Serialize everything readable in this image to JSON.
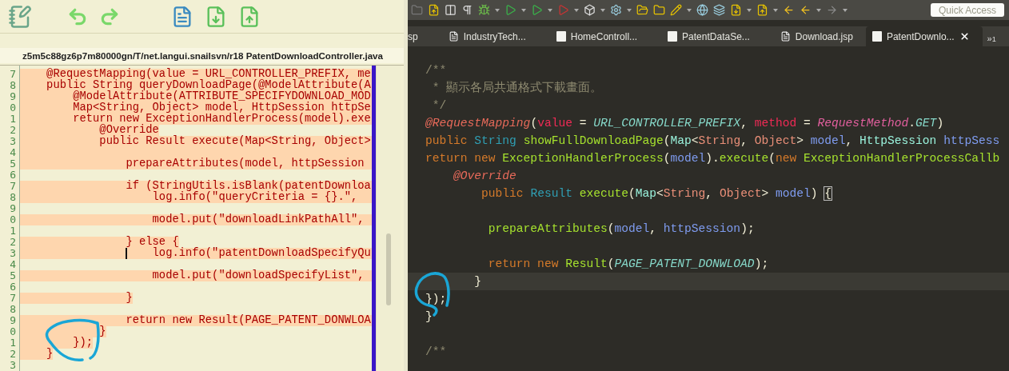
{
  "compare_panel": {
    "file_path": "z5m5c88gz6p7m80000gn/T/net.langui.snailsvn/r18 PatentDownloadController.java",
    "lines": [
      {
        "number": "7",
        "changed": true,
        "kind": "full",
        "cursor": false,
        "text": "    @RequestMapping(value = URL_CONTROLLER_PREFIX, me"
      },
      {
        "number": "8",
        "changed": true,
        "kind": "full",
        "cursor": false,
        "text": "    public String queryDownloadPage(@ModelAttribute(A"
      },
      {
        "number": "9",
        "changed": true,
        "kind": "full",
        "cursor": false,
        "text": "        @ModelAttribute(ATTRIBUTE_SPECIFYDOWNLOAD_MOD"
      },
      {
        "number": "0",
        "changed": true,
        "kind": "full",
        "cursor": false,
        "text": "        Map<String, Object> model, HttpSession httpSe"
      },
      {
        "number": "1",
        "changed": true,
        "kind": "full",
        "cursor": false,
        "text": "        return new ExceptionHandlerProcess(model).exe"
      },
      {
        "number": "2",
        "changed": true,
        "kind": "text",
        "cursor": false,
        "text": "            @Override"
      },
      {
        "number": "3",
        "changed": true,
        "kind": "full",
        "cursor": false,
        "text": "            public Result execute(Map<String, Object>"
      },
      {
        "number": "4",
        "changed": true,
        "kind": "full",
        "cursor": false
      },
      {
        "number": "5",
        "changed": true,
        "kind": "full",
        "cursor": false,
        "text": "                prepareAttributes(model, httpSession"
      },
      {
        "number": "6",
        "changed": false,
        "cursor": false
      },
      {
        "number": "7",
        "changed": true,
        "kind": "full",
        "cursor": false,
        "text": "                if (StringUtils.isBlank(patentDownloa"
      },
      {
        "number": "8",
        "changed": true,
        "kind": "full",
        "cursor": false,
        "text": "                    log.info(\"queryCriteria = {}.\","
      },
      {
        "number": "9",
        "changed": false,
        "cursor": false
      },
      {
        "number": "0",
        "changed": true,
        "kind": "full",
        "cursor": false,
        "text": "                    model.put(\"downloadLinkPathAll\","
      },
      {
        "number": "1",
        "changed": false,
        "cursor": false
      },
      {
        "number": "2",
        "changed": true,
        "kind": "text",
        "cursor": false,
        "text": "                } else {"
      },
      {
        "number": "3",
        "changed": true,
        "kind": "full",
        "cursor": true,
        "text": "                    log.info(\"patentDownloadSpecifyQu"
      },
      {
        "number": "4",
        "changed": false,
        "cursor": false
      },
      {
        "number": "5",
        "changed": true,
        "kind": "full",
        "cursor": false,
        "text": "                    model.put(\"downloadSpecifyList\","
      },
      {
        "number": "6",
        "changed": false,
        "cursor": false
      },
      {
        "number": "7",
        "changed": true,
        "kind": "text",
        "cursor": false,
        "text": "                }"
      },
      {
        "number": "8",
        "changed": false,
        "cursor": false
      },
      {
        "number": "9",
        "changed": true,
        "kind": "full",
        "cursor": false,
        "text": "                return new Result(PAGE_PATENT_DONWLOA"
      },
      {
        "number": "0",
        "changed": true,
        "kind": "text",
        "cursor": false,
        "text": "            }"
      },
      {
        "number": "1",
        "changed": true,
        "kind": "text",
        "cursor": false,
        "text": "        });"
      },
      {
        "number": "2",
        "changed": true,
        "kind": "text",
        "cursor": false,
        "text": "    }"
      },
      {
        "number": "3",
        "changed": false,
        "cursor": false
      }
    ]
  },
  "ide": {
    "quick_access": {
      "placeholder": "Quick Access"
    },
    "tabs": [
      {
        "label": "sp",
        "kind": "cut",
        "selected": false
      },
      {
        "label": "IndustryTech...",
        "kind": "jsp",
        "selected": false
      },
      {
        "label": "HomeControll...",
        "kind": "java",
        "selected": false
      },
      {
        "label": "PatentDataSe...",
        "kind": "java",
        "selected": false
      },
      {
        "label": "Download.jsp",
        "kind": "jsp",
        "selected": false
      },
      {
        "label": "PatentDownlo...",
        "kind": "java",
        "selected": true
      }
    ],
    "overflow": {
      "label": "»",
      "count": "1"
    },
    "lines": [
      {
        "current": false,
        "tokens": [
          {
            "text": "/**",
            "kind": "comment"
          }
        ]
      },
      {
        "current": false,
        "tokens": [
          {
            "text": " * 顯示各局共通格式下載畫面。",
            "kind": "comment"
          }
        ]
      },
      {
        "current": false,
        "tokens": [
          {
            "text": " */",
            "kind": "comment"
          }
        ]
      },
      {
        "current": false,
        "tokens": [
          {
            "text": "@RequestMapping",
            "kind": "annotation"
          },
          {
            "text": "(",
            "kind": "plain"
          },
          {
            "text": "value",
            "kind": "attr"
          },
          {
            "text": " = ",
            "kind": "plain"
          },
          {
            "text": "URL_CONTROLLER_PREFIX",
            "kind": "constant"
          },
          {
            "text": ", ",
            "kind": "plain"
          },
          {
            "text": "method",
            "kind": "attr"
          },
          {
            "text": " = ",
            "kind": "plain"
          },
          {
            "text": "RequestMethod",
            "kind": "static"
          },
          {
            "text": ".",
            "kind": "plain"
          },
          {
            "text": "GET",
            "kind": "constant"
          },
          {
            "text": ")",
            "kind": "plain"
          }
        ]
      },
      {
        "current": false,
        "tokens": [
          {
            "text": "public ",
            "kind": "keyword"
          },
          {
            "text": "String ",
            "kind": "type"
          },
          {
            "text": "showFullDownloadPage",
            "kind": "method"
          },
          {
            "text": "(",
            "kind": "plain"
          },
          {
            "text": "Map",
            "kind": "typeref"
          },
          {
            "text": "<",
            "kind": "plain"
          },
          {
            "text": "String",
            "kind": "generic"
          },
          {
            "text": ", ",
            "kind": "plain"
          },
          {
            "text": "Object",
            "kind": "generic"
          },
          {
            "text": "> ",
            "kind": "plain"
          },
          {
            "text": "model",
            "kind": "variable"
          },
          {
            "text": ", ",
            "kind": "plain"
          },
          {
            "text": "HttpSession ",
            "kind": "typeref"
          },
          {
            "text": "httpSess",
            "kind": "variable"
          }
        ]
      },
      {
        "current": false,
        "tokens": [
          {
            "text": "return new ",
            "kind": "keyword"
          },
          {
            "text": "ExceptionHandlerProcess",
            "kind": "method"
          },
          {
            "text": "(",
            "kind": "plain"
          },
          {
            "text": "model",
            "kind": "variable"
          },
          {
            "text": ").",
            "kind": "plain"
          },
          {
            "text": "execute",
            "kind": "method"
          },
          {
            "text": "(",
            "kind": "plain"
          },
          {
            "text": "new ",
            "kind": "keyword"
          },
          {
            "text": "ExceptionHandlerProcessCallb",
            "kind": "method"
          }
        ]
      },
      {
        "current": false,
        "tokens": [
          {
            "text": "    @Override",
            "kind": "annotation"
          }
        ]
      },
      {
        "current": false,
        "tokens": [
          {
            "text": "        public ",
            "kind": "keyword"
          },
          {
            "text": "Result ",
            "kind": "type"
          },
          {
            "text": "execute",
            "kind": "method"
          },
          {
            "text": "(",
            "kind": "plain"
          },
          {
            "text": "Map",
            "kind": "typeref"
          },
          {
            "text": "<",
            "kind": "plain"
          },
          {
            "text": "String",
            "kind": "generic"
          },
          {
            "text": ", ",
            "kind": "plain"
          },
          {
            "text": "Object",
            "kind": "generic"
          },
          {
            "text": "> ",
            "kind": "plain"
          },
          {
            "text": "model",
            "kind": "variable"
          },
          {
            "text": ") ",
            "kind": "plain"
          },
          {
            "text": "{",
            "kind": "matched"
          }
        ]
      },
      {
        "current": false
      },
      {
        "current": false,
        "tokens": [
          {
            "text": "         prepareAttributes",
            "kind": "method"
          },
          {
            "text": "(",
            "kind": "plain"
          },
          {
            "text": "model",
            "kind": "variable"
          },
          {
            "text": ", ",
            "kind": "plain"
          },
          {
            "text": "httpSession",
            "kind": "variable"
          },
          {
            "text": ");",
            "kind": "plain"
          }
        ]
      },
      {
        "current": false
      },
      {
        "current": false,
        "tokens": [
          {
            "text": "         return new ",
            "kind": "keyword"
          },
          {
            "text": "Result",
            "kind": "method"
          },
          {
            "text": "(",
            "kind": "plain"
          },
          {
            "text": "PAGE_PATENT_DONWLOAD",
            "kind": "constant"
          },
          {
            "text": ");",
            "kind": "plain"
          }
        ]
      },
      {
        "current": true,
        "tokens": [
          {
            "text": "       }",
            "kind": "plain"
          }
        ]
      },
      {
        "current": false,
        "tokens": [
          {
            "text": "});",
            "kind": "plain"
          }
        ]
      },
      {
        "current": false,
        "tokens": [
          {
            "text": "}",
            "kind": "plain"
          }
        ]
      },
      {
        "current": false
      },
      {
        "current": false,
        "tokens": [
          {
            "text": "/**",
            "kind": "comment"
          }
        ]
      }
    ]
  }
}
